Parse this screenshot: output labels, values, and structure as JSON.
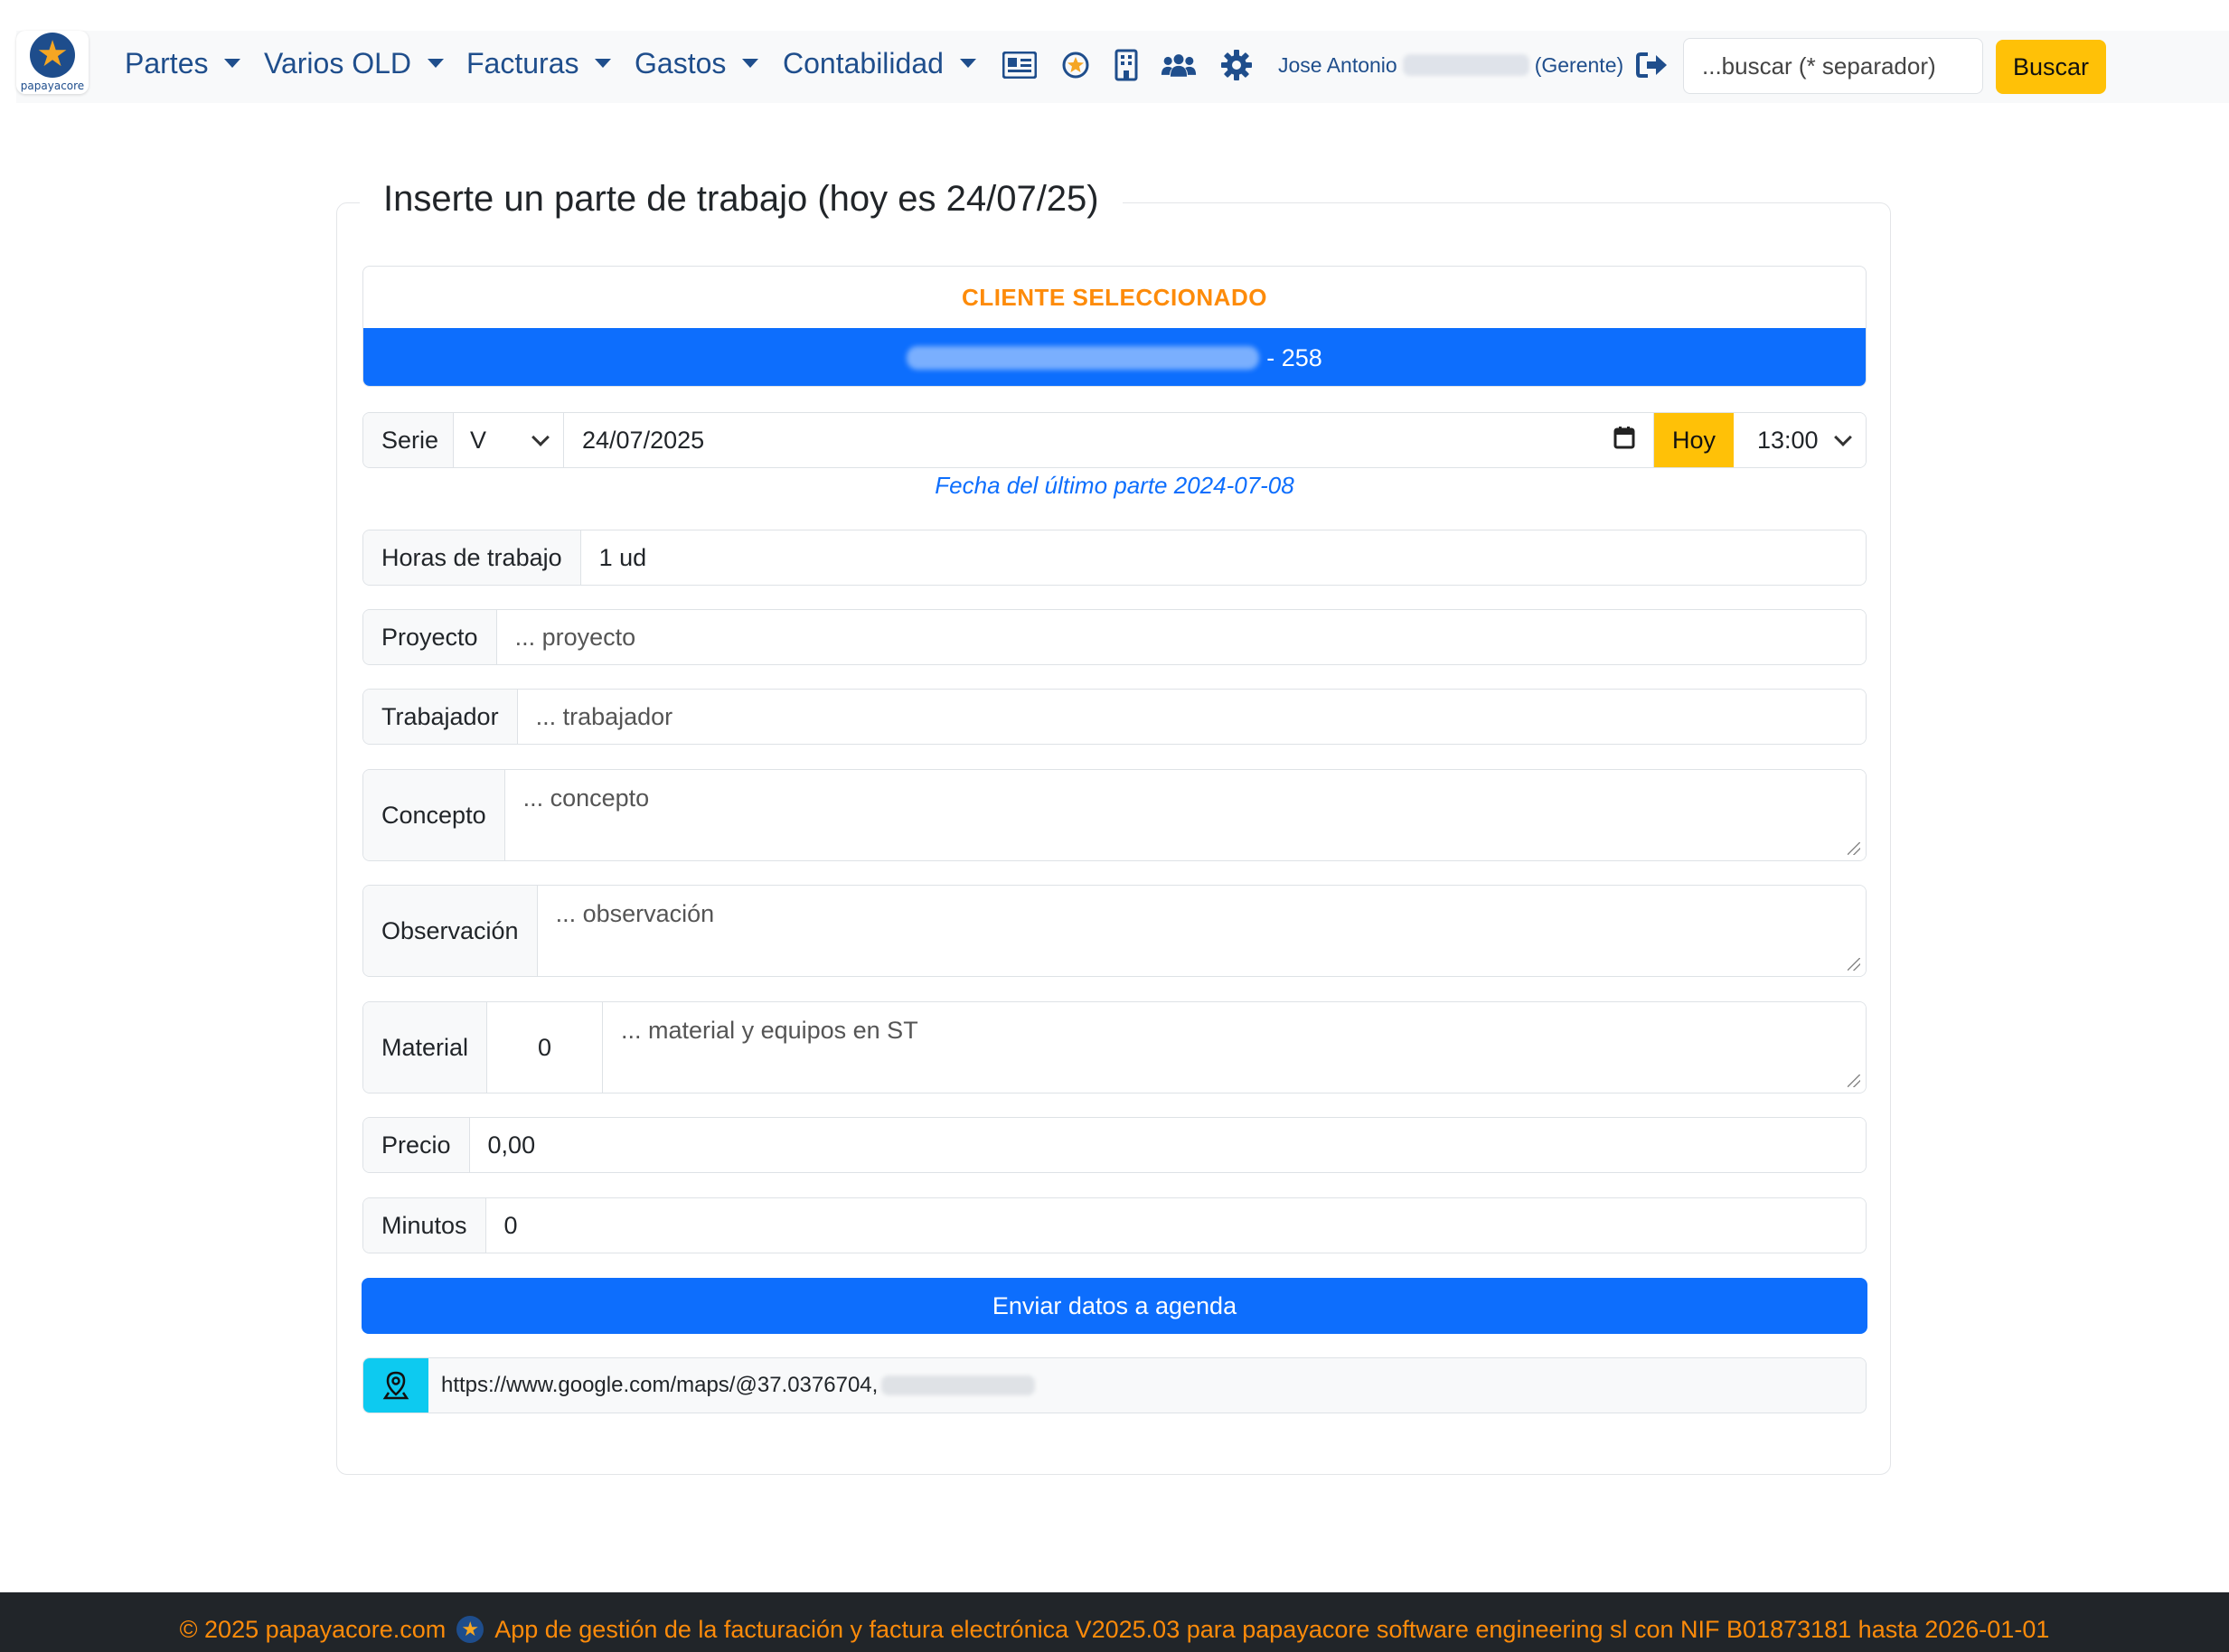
{
  "brand": {
    "name": "papayacore"
  },
  "nav": {
    "items": [
      {
        "label": "Partes"
      },
      {
        "label": "Varios OLD"
      },
      {
        "label": "Facturas"
      },
      {
        "label": "Gastos"
      },
      {
        "label": "Contabilidad"
      }
    ],
    "icons": [
      "id-card-icon",
      "star-badge-icon",
      "building-icon",
      "users-icon",
      "gear-icon"
    ],
    "user": {
      "first_name": "Jose Antonio",
      "role": "(Gerente)"
    },
    "logout_icon": "sign-out-icon",
    "search_placeholder": "...buscar (* separador)",
    "search_button": "Buscar"
  },
  "form": {
    "legend": "Inserte un parte de trabajo (hoy es 24/07/25)",
    "client_header": "CLIENTE SELECCIONADO",
    "client_suffix": "- 258",
    "serie_label": "Serie",
    "serie_value": "V",
    "date_value": "24/07/2025",
    "today_button": "Hoy",
    "time_value": "13:00",
    "last_part_note": "Fecha del último parte 2024-07-08",
    "horas_label": "Horas de trabajo",
    "horas_value": "1 ud",
    "proyecto_label": "Proyecto",
    "proyecto_placeholder": "... proyecto",
    "trabajador_label": "Trabajador",
    "trabajador_placeholder": "... trabajador",
    "concepto_label": "Concepto",
    "concepto_placeholder": "... concepto",
    "observacion_label": "Observación",
    "observacion_placeholder": "... observación",
    "material_label": "Material",
    "material_qty": "0",
    "material_placeholder": "... material y equipos en ST",
    "precio_label": "Precio",
    "precio_value": "0,00",
    "minutos_label": "Minutos",
    "minutos_value": "0",
    "submit_label": "Enviar datos a agenda",
    "map_url": "https://www.google.com/maps/@37.0376704,"
  },
  "footer": {
    "left": "© 2025 papayacore.com",
    "right": "App de gestión de la facturación y factura electrónica V2025.03 para papayacore software engineering sl con NIF B01873181 hasta 2026-01-01"
  },
  "colors": {
    "primary": "#0d6efd",
    "warning": "#ffc107",
    "orange": "#fd8b0a",
    "nav_text": "#1f4e8c",
    "info": "#0dcaf0",
    "footer_bg": "#212529"
  }
}
